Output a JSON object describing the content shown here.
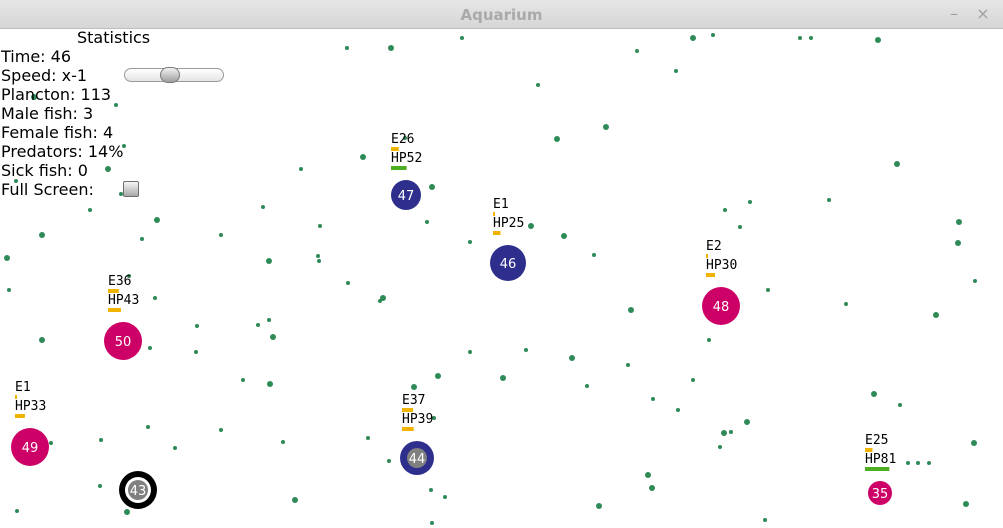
{
  "window": {
    "title": "Aquarium",
    "minimize_glyph": "–",
    "close_glyph": "×"
  },
  "stats": {
    "heading": "Statistics",
    "time": "Time: 46",
    "speed": "Speed: x-1",
    "plancton": "Plancton: 113",
    "male_fish": "Male fish: 3",
    "female_fish": "Female fish: 4",
    "predators": "Predators: 14%",
    "sick_fish": "Sick fish: 0",
    "full_screen": "Full Screen:"
  },
  "colors": {
    "plankton": "#2e8b57",
    "male": "#2e2e8c",
    "female": "#cc0066",
    "predator_outline": "#000000",
    "sick_core": "#808080",
    "energy_bar": "#f0b400",
    "hp_bar": "#4caf22"
  },
  "fish": [
    {
      "id": "fish-47",
      "kind": "male",
      "age": "47",
      "energy": "E26",
      "hp": "HP52",
      "energy_level": 0.26,
      "hp_level": 0.52,
      "sick": false
    },
    {
      "id": "fish-46",
      "kind": "male",
      "age": "46",
      "energy": "E1",
      "hp": "HP25",
      "energy_level": 0.01,
      "hp_level": 0.25,
      "sick": false
    },
    {
      "id": "fish-48",
      "kind": "female",
      "age": "48",
      "energy": "E2",
      "hp": "HP30",
      "energy_level": 0.02,
      "hp_level": 0.3,
      "sick": false
    },
    {
      "id": "fish-50",
      "kind": "female",
      "age": "50",
      "energy": "E36",
      "hp": "HP43",
      "energy_level": 0.36,
      "hp_level": 0.43,
      "sick": false
    },
    {
      "id": "fish-49",
      "kind": "female",
      "age": "49",
      "energy": "E1",
      "hp": "HP33",
      "energy_level": 0.01,
      "hp_level": 0.33,
      "sick": false
    },
    {
      "id": "fish-44",
      "kind": "male",
      "age": "44",
      "energy": "E37",
      "hp": "HP39",
      "energy_level": 0.37,
      "hp_level": 0.39,
      "sick": true
    },
    {
      "id": "fish-35",
      "kind": "female",
      "age": "35",
      "energy": "E25",
      "hp": "HP81",
      "energy_level": 0.25,
      "hp_level": 0.81,
      "sick": false
    },
    {
      "id": "fish-43",
      "kind": "predator",
      "age": "43",
      "energy": "",
      "hp": "",
      "energy_level": 0,
      "hp_level": 0,
      "sick": true
    }
  ]
}
